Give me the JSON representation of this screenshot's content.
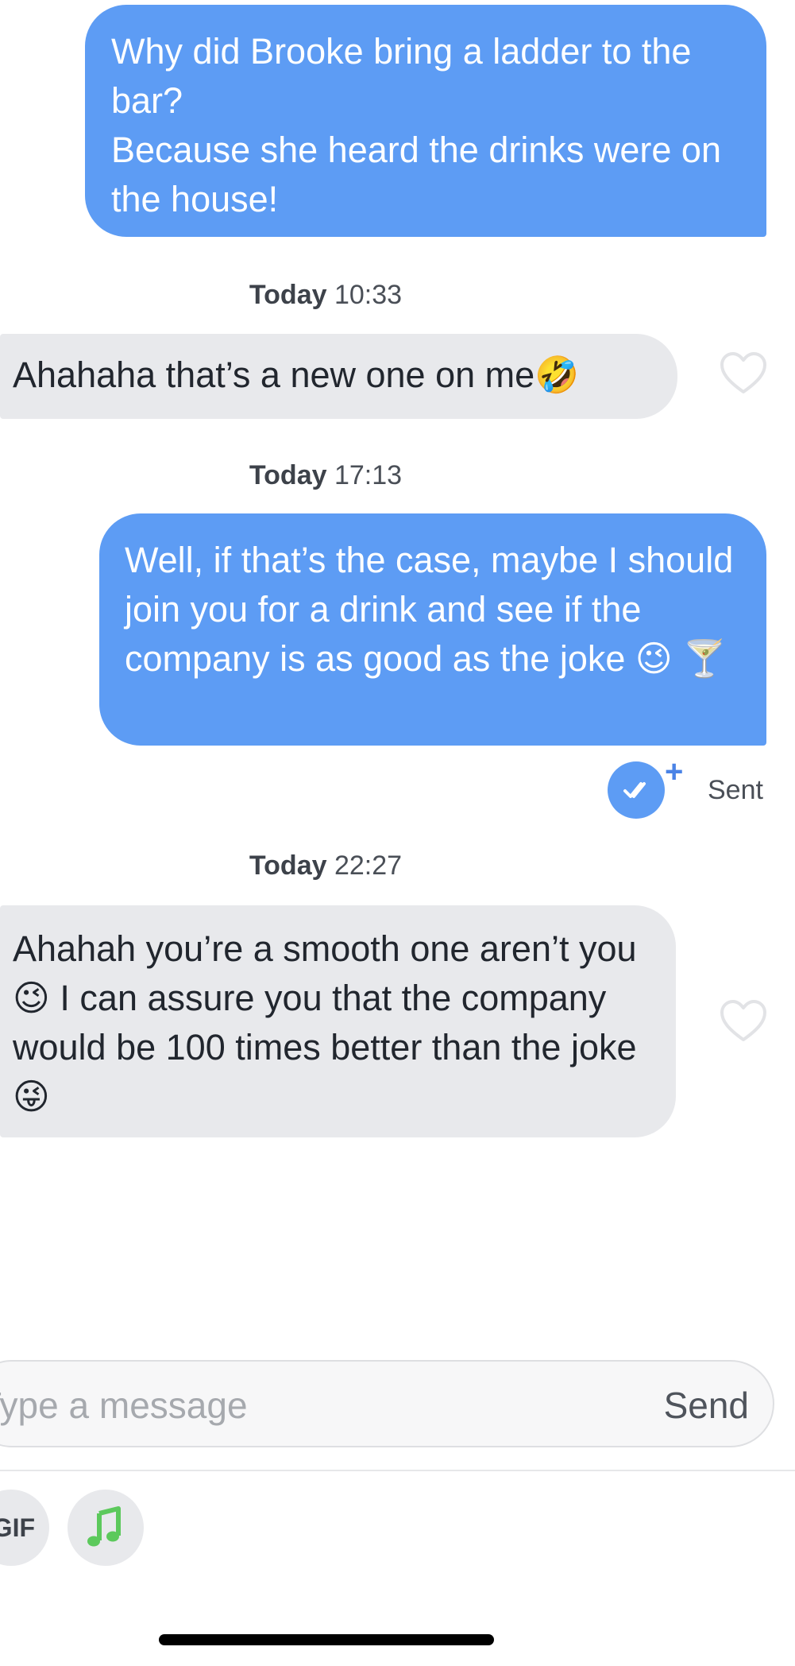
{
  "messages": [
    {
      "direction": "outgoing",
      "text": "Why did Brooke bring a ladder to the bar?\nBecause she heard the drinks were on the house!"
    },
    {
      "direction": "incoming",
      "timestamp": {
        "day": "Today",
        "time": "10:33"
      },
      "text": "Ahahaha that’s a new one on me🤣"
    },
    {
      "direction": "outgoing",
      "timestamp": {
        "day": "Today",
        "time": "17:13"
      },
      "text": "Well, if that’s the case, maybe I should join you for a drink and see if the company is as good as the joke 😉 🍸",
      "status": "Sent"
    },
    {
      "direction": "incoming",
      "timestamp": {
        "day": "Today",
        "time": "22:27"
      },
      "text": "Ahahah you’re a smooth one aren’t you😉 I can assure you that the company would be 100 times better than the joke😜"
    }
  ],
  "composer": {
    "placeholder": "Type a message",
    "send_label": "Send"
  },
  "toolbar": {
    "gif_label": "GIF",
    "music_icon": "music-note-icon"
  },
  "colors": {
    "outgoing_bubble": "#5d9cf4",
    "incoming_bubble": "#e8e9ec",
    "music_icon": "#5cc95c",
    "sent_check": "#5d9cf4"
  }
}
